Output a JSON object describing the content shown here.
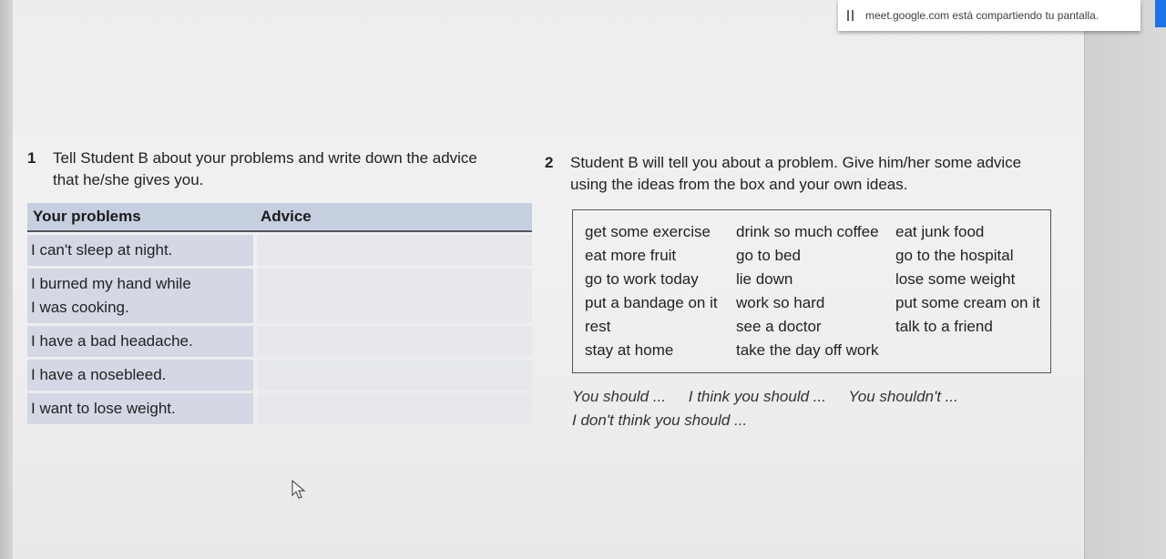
{
  "banner": {
    "text": "meet.google.com está compartiendo tu pantalla."
  },
  "exercise1": {
    "number": "1",
    "line1": "Tell Student B about your problems and write down the advice",
    "line2": "that he/she gives you.",
    "headers": [
      "Your problems",
      "Advice"
    ],
    "rows": [
      [
        "I can't sleep at night."
      ],
      [
        "I burned my hand while",
        "I was cooking."
      ],
      [
        "I have a bad headache."
      ],
      [
        "I have a nosebleed."
      ],
      [
        "I want to lose weight."
      ]
    ]
  },
  "exercise2": {
    "number": "2",
    "line1": "Student B will tell you about a problem. Give him/her some advice",
    "line2": "using the ideas from the box and your own ideas.",
    "col1": [
      "get some exercise",
      "eat more fruit",
      "go to work today",
      "put a bandage on it",
      "rest",
      "stay at home"
    ],
    "col2": [
      "drink so much coffee",
      "go to bed",
      "lie down",
      "work so hard",
      "see a doctor",
      "take the day off work"
    ],
    "col3": [
      "eat junk food",
      "go to the hospital",
      "lose some weight",
      "put some cream on it",
      "talk to a friend"
    ],
    "phrases": [
      "You should ...",
      "I think you should ...",
      "You shouldn't ..."
    ],
    "phrase_line2": "I don't think you should ..."
  }
}
